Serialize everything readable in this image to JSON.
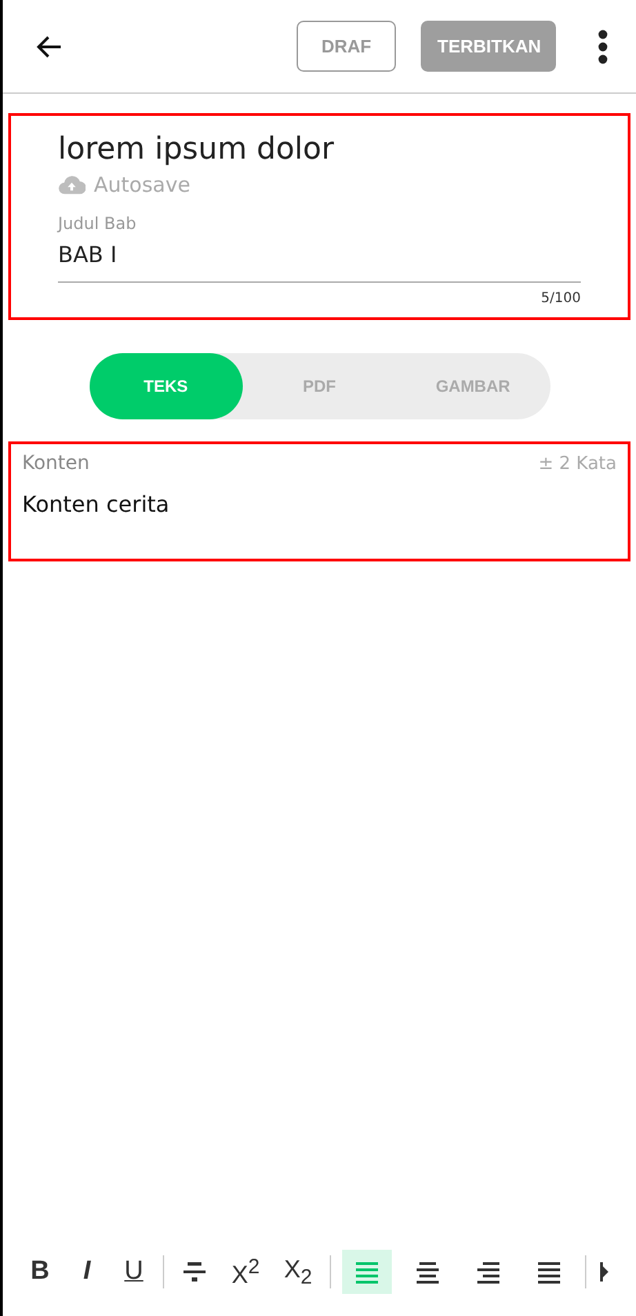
{
  "header": {
    "buttons": [
      {
        "label": "DRAF",
        "kind": "outline"
      },
      {
        "label": "TERBITKAN",
        "kind": "filled"
      }
    ]
  },
  "story": {
    "title": "lorem ipsum dolor",
    "autosave": "Autosave",
    "field": {
      "label": "Judul Bab",
      "value": "BAB I",
      "counter": "5/100"
    }
  },
  "tabs": [
    {
      "label": "TEKS",
      "selected": true
    },
    {
      "label": "PDF",
      "selected": false
    },
    {
      "label": "GAMBAR",
      "selected": false
    }
  ],
  "content": {
    "label": "Konten",
    "word_count": "± 2 Kata",
    "text": "Konten cerita"
  },
  "toolbar": [
    {
      "kind": "bold",
      "glyph": "B"
    },
    {
      "kind": "italic",
      "glyph": "I"
    },
    {
      "kind": "underline",
      "glyph": "U"
    },
    {
      "kind": "divider"
    },
    {
      "kind": "strike"
    },
    {
      "kind": "script",
      "glyph": "X$^{2}$"
    },
    {
      "kind": "script",
      "glyph": "X$_{2}$"
    },
    {
      "kind": "divider"
    },
    {
      "kind": "left",
      "selected": true
    },
    {
      "kind": "center",
      "selected": false
    },
    {
      "kind": "right",
      "selected": false
    },
    {
      "kind": "justify",
      "selected": false
    },
    {
      "kind": "divider"
    },
    {
      "kind": "more"
    }
  ]
}
